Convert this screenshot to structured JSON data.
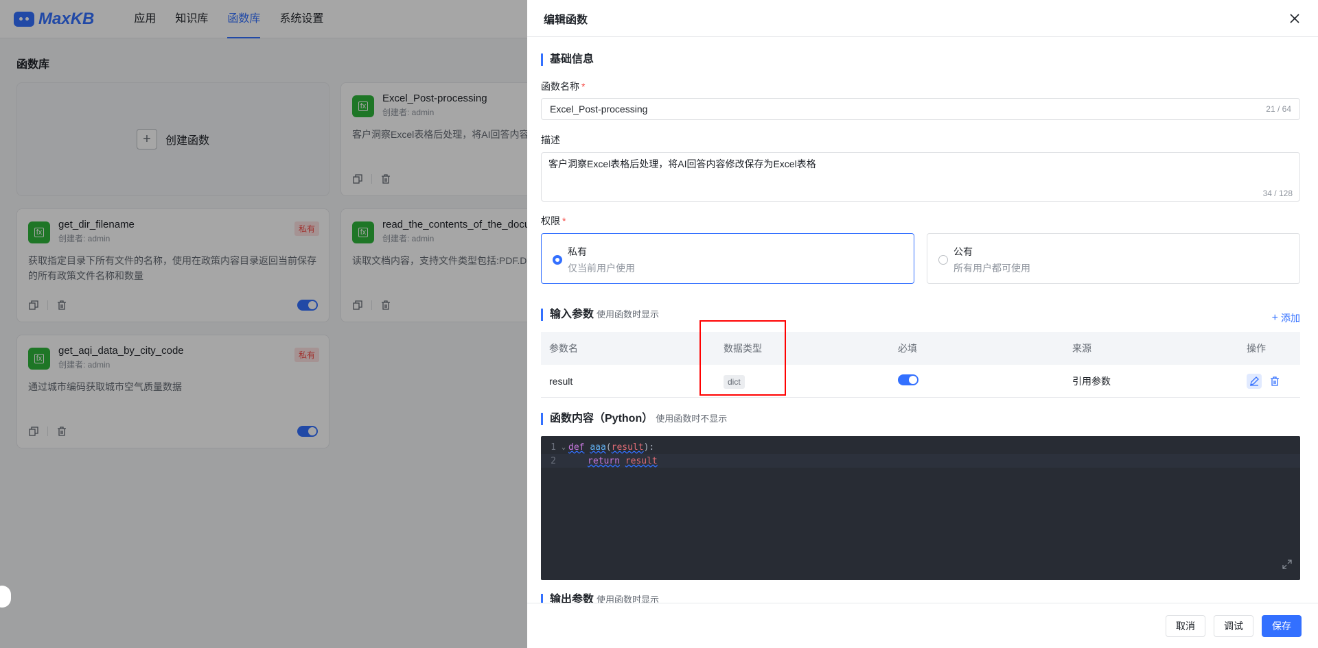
{
  "app": {
    "logo_text": "MaxKB"
  },
  "nav": {
    "items": [
      "应用",
      "知识库",
      "函数库",
      "系统设置"
    ],
    "active": 2
  },
  "page": {
    "title": "函数库"
  },
  "cards": {
    "create_label": "创建函数",
    "author_prefix": "创建者: ",
    "items": [
      {
        "name": "Excel_Post-processing",
        "author": "创建者: admin",
        "tag": "",
        "desc": "客户洞察Excel表格后处理，将AI回答内容修",
        "enabled": false
      },
      {
        "name": "get_dir_filename",
        "author": "创建者: admin",
        "tag": "私有",
        "desc": "获取指定目录下所有文件的名称，使用在政策内容目录返回当前保存的所有政策文件名称和数量",
        "enabled": true
      },
      {
        "name": "read_the_contents_of_the_docu",
        "author": "创建者: admin",
        "tag": "",
        "desc": "读取文档内容，支持文件类型包括:PDF.DOC ML.CSV",
        "enabled": false
      },
      {
        "name": "get_aqi_data_by_city_code",
        "author": "创建者: admin",
        "tag": "私有",
        "desc": "通过城市编码获取城市空气质量数据",
        "enabled": true
      }
    ]
  },
  "drawer": {
    "title": "编辑函数",
    "basic_section": "基础信息",
    "name_label": "函数名称",
    "name_value": "Excel_Post-processing",
    "name_counter": "21 / 64",
    "desc_label": "描述",
    "desc_value": "客户洞察Excel表格后处理，将AI回答内容修改保存为Excel表格",
    "desc_counter": "34 / 128",
    "perm_label": "权限",
    "perm_private_label": "私有",
    "perm_private_desc": "仅当前用户使用",
    "perm_public_label": "公有",
    "perm_public_desc": "所有用户都可使用",
    "input_section": "输入参数",
    "input_section_sub": "使用函数时显示",
    "add_label": "添加",
    "table": {
      "headers": [
        "参数名",
        "数据类型",
        "必填",
        "来源",
        "操作"
      ],
      "rows": [
        {
          "name": "result",
          "type": "dict",
          "required": true,
          "source": "引用参数"
        }
      ]
    },
    "code_section": "函数内容（Python）",
    "code_section_sub": "使用函数时不显示",
    "code_lines": [
      {
        "no": "1",
        "kw": "def",
        "fn": "aaa",
        "p1": "(",
        "arg": "result",
        "p2": "):"
      },
      {
        "no": "2",
        "kw": "return",
        "arg": "result"
      }
    ],
    "output_section": "输出参数",
    "output_section_sub": "使用函数时显示",
    "buttons": {
      "cancel": "取消",
      "debug": "调试",
      "save": "保存"
    }
  }
}
